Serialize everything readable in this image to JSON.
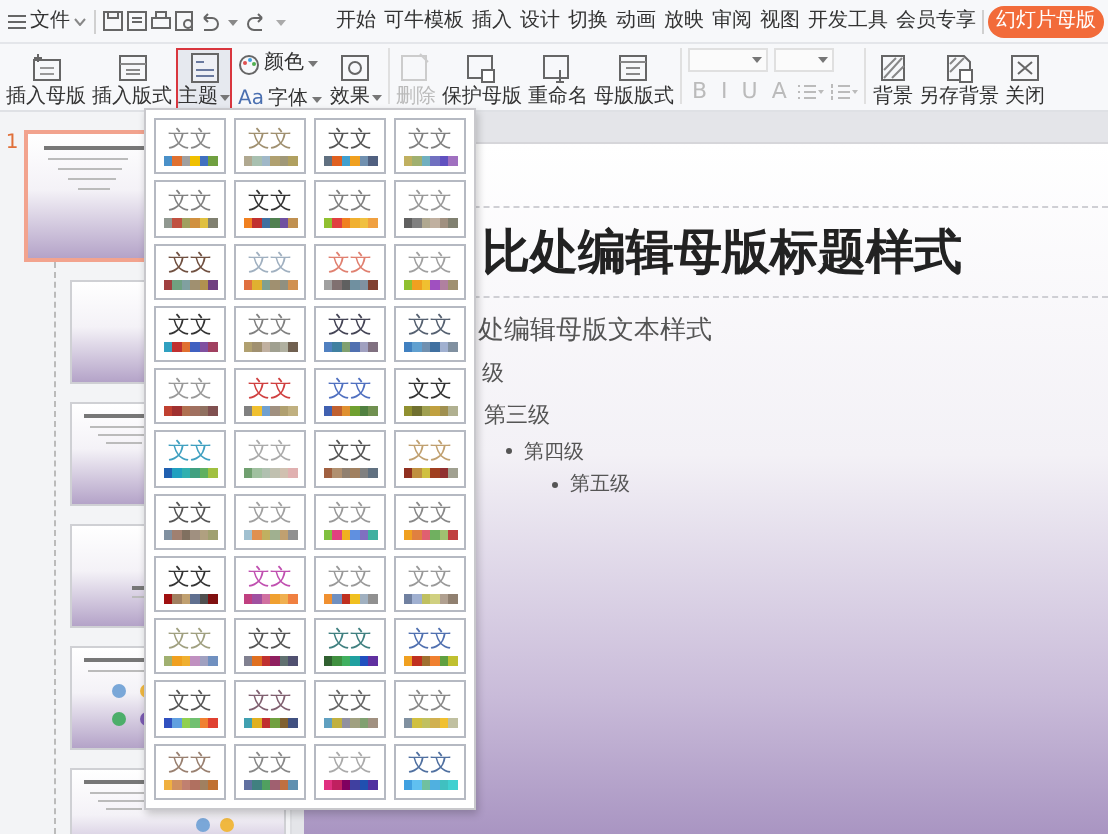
{
  "menu_bar": {
    "file_label": "文件",
    "tabs": [
      {
        "label": "开始",
        "selected": false
      },
      {
        "label": "可牛模板",
        "selected": false
      },
      {
        "label": "插入",
        "selected": false
      },
      {
        "label": "设计",
        "selected": false
      },
      {
        "label": "切换",
        "selected": false
      },
      {
        "label": "动画",
        "selected": false
      },
      {
        "label": "放映",
        "selected": false
      },
      {
        "label": "审阅",
        "selected": false
      },
      {
        "label": "视图",
        "selected": false
      },
      {
        "label": "开发工具",
        "selected": false
      },
      {
        "label": "会员专享",
        "selected": false
      },
      {
        "label": "幻灯片母版",
        "selected": true
      }
    ]
  },
  "ribbon": {
    "groups": [
      {
        "kind": "large",
        "label": "插入母版",
        "dropdown": false,
        "active": false,
        "disabled": false
      },
      {
        "kind": "large",
        "label": "插入版式",
        "dropdown": false,
        "active": false,
        "disabled": false
      },
      {
        "kind": "large",
        "label": "主题",
        "dropdown": true,
        "active": true,
        "disabled": false
      },
      {
        "kind": "stack",
        "items": [
          {
            "label": "颜色",
            "dropdown": true
          },
          {
            "label": "字体",
            "badge": "Aa",
            "dropdown": true
          }
        ]
      },
      {
        "kind": "large",
        "label": "效果",
        "dropdown": true,
        "active": false,
        "disabled": false
      },
      {
        "kind": "large",
        "label": "删除",
        "dropdown": false,
        "active": false,
        "disabled": true
      },
      {
        "kind": "large",
        "label": "保护母版",
        "dropdown": false,
        "active": false,
        "disabled": false
      },
      {
        "kind": "large",
        "label": "重命名",
        "dropdown": false,
        "active": false,
        "disabled": false
      },
      {
        "kind": "large",
        "label": "母版版式",
        "dropdown": false,
        "active": false,
        "disabled": false
      },
      {
        "kind": "font",
        "disabled": true,
        "format_buttons": [
          "B",
          "I",
          "U",
          "A"
        ]
      },
      {
        "kind": "large",
        "label": "背景",
        "dropdown": false,
        "active": false,
        "disabled": false
      },
      {
        "kind": "large",
        "label": "另存背景",
        "dropdown": false,
        "active": false,
        "disabled": false
      },
      {
        "kind": "large",
        "label": "关闭",
        "dropdown": false,
        "active": false,
        "disabled": false
      }
    ]
  },
  "thumbnails": [
    {
      "kind": "master",
      "number": "1",
      "selected": true
    },
    {
      "kind": "title",
      "selected": false
    },
    {
      "kind": "content_icons",
      "selected": false
    },
    {
      "kind": "section",
      "selected": false
    },
    {
      "kind": "icons",
      "selected": false
    },
    {
      "kind": "content_icons",
      "selected": false
    }
  ],
  "slide": {
    "title": "比处编辑母版标题样式",
    "body": [
      {
        "text": "处编辑母版文本样式",
        "bullet": false,
        "children": [
          {
            "text": "级",
            "bullet": false,
            "children": [
              {
                "text": "第三级",
                "bullet": false,
                "children": [
                  {
                    "text": "第四级",
                    "bullet": true,
                    "children": [
                      {
                        "text": "第五级",
                        "bullet": true
                      }
                    ]
                  }
                ]
              }
            ]
          }
        ]
      }
    ]
  },
  "themes": [
    {
      "label": "文文",
      "color": "#888888",
      "swatches": [
        {
          "color": "#4a90c8"
        },
        {
          "color": "#e07030"
        },
        {
          "color": "#a0a0a0"
        },
        {
          "color": "#f0c000"
        },
        {
          "color": "#4070c0"
        },
        {
          "color": "#70a040"
        }
      ]
    },
    {
      "label": "文文",
      "color": "#a09070",
      "swatches": [
        {
          "color": "#b0a890"
        },
        {
          "color": "#a8c0b0"
        },
        {
          "color": "#a0b8c8"
        },
        {
          "color": "#b0a070"
        },
        {
          "color": "#a09878"
        },
        {
          "color": "#b0a060"
        }
      ]
    },
    {
      "label": "文文",
      "color": "#555555",
      "swatches": [
        {
          "color": "#607080"
        },
        {
          "color": "#e06020"
        },
        {
          "color": "#40a0d0"
        },
        {
          "color": "#f0a020"
        },
        {
          "color": "#7090b0"
        },
        {
          "color": "#506080"
        }
      ]
    },
    {
      "label": "文文",
      "color": "#808080",
      "swatches": [
        {
          "color": "#c0b060"
        },
        {
          "color": "#a0b070"
        },
        {
          "color": "#70b0c0"
        },
        {
          "color": "#7070c0"
        },
        {
          "color": "#6050c0"
        },
        {
          "color": "#a070c0"
        }
      ]
    },
    {
      "label": "文文",
      "color": "#808080",
      "swatches": [
        {
          "color": "#909890"
        },
        {
          "color": "#c05040"
        },
        {
          "color": "#a0a060"
        },
        {
          "color": "#d09040"
        },
        {
          "color": "#e0c040"
        },
        {
          "color": "#808070"
        }
      ]
    },
    {
      "label": "文文",
      "color": "#333333",
      "swatches": [
        {
          "color": "#f08020"
        },
        {
          "color": "#c03030"
        },
        {
          "color": "#4070a0"
        },
        {
          "color": "#508050"
        },
        {
          "color": "#7050a0"
        },
        {
          "color": "#c09050"
        }
      ]
    },
    {
      "label": "文文",
      "color": "#808080",
      "swatches": [
        {
          "color": "#90c030"
        },
        {
          "color": "#e04040"
        },
        {
          "color": "#f08020"
        },
        {
          "color": "#f0b030"
        },
        {
          "color": "#f0c040"
        },
        {
          "color": "#f0a040"
        }
      ]
    },
    {
      "label": "文文",
      "color": "#999999",
      "swatches": [
        {
          "color": "#606060"
        },
        {
          "color": "#808080"
        },
        {
          "color": "#b0a890"
        },
        {
          "color": "#c0b0a0"
        },
        {
          "color": "#a09080"
        },
        {
          "color": "#808070"
        }
      ]
    },
    {
      "label": "文文",
      "color": "#705040",
      "swatches": [
        {
          "color": "#a04040"
        },
        {
          "color": "#70a080"
        },
        {
          "color": "#80a0a0"
        },
        {
          "color": "#a09070"
        },
        {
          "color": "#b09050"
        },
        {
          "color": "#704080"
        }
      ]
    },
    {
      "label": "文文",
      "color": "#a0b0c0",
      "swatches": [
        {
          "color": "#e07040"
        },
        {
          "color": "#e0b030"
        },
        {
          "color": "#80a090"
        },
        {
          "color": "#a09070"
        },
        {
          "color": "#909080"
        },
        {
          "color": "#d09050"
        }
      ]
    },
    {
      "label": "文文",
      "color": "#e08070",
      "swatches": [
        {
          "color": "#a0a0a0"
        },
        {
          "color": "#807070"
        },
        {
          "color": "#606060"
        },
        {
          "color": "#7090a0"
        },
        {
          "color": "#8090a0"
        },
        {
          "color": "#804030"
        }
      ]
    },
    {
      "label": "文文",
      "color": "#a0a0a0",
      "swatches": [
        {
          "color": "#90c030"
        },
        {
          "color": "#f0a020"
        },
        {
          "color": "#f0c030"
        },
        {
          "color": "#a050c0"
        },
        {
          "color": "#b080a0"
        },
        {
          "color": "#a09070"
        }
      ]
    },
    {
      "label": "文文",
      "color": "#333333",
      "swatches": [
        {
          "color": "#30a0c0"
        },
        {
          "color": "#c03030"
        },
        {
          "color": "#e07030"
        },
        {
          "color": "#4060c0"
        },
        {
          "color": "#8050a0"
        },
        {
          "color": "#a04060"
        }
      ]
    },
    {
      "label": "文文",
      "color": "#808080",
      "swatches": [
        {
          "color": "#b0a070"
        },
        {
          "color": "#a09070"
        },
        {
          "color": "#c0b0a0"
        },
        {
          "color": "#a0a090"
        },
        {
          "color": "#b0b0a0"
        },
        {
          "color": "#706050"
        }
      ]
    },
    {
      "label": "文文",
      "color": "#444455",
      "swatches": [
        {
          "color": "#5080c0"
        },
        {
          "color": "#4080a0"
        },
        {
          "color": "#80a070"
        },
        {
          "color": "#5070b0"
        },
        {
          "color": "#a0a0c0"
        },
        {
          "color": "#807080"
        }
      ]
    },
    {
      "label": "文文",
      "color": "#556070",
      "swatches": [
        {
          "color": "#4080c0"
        },
        {
          "color": "#60a0d0"
        },
        {
          "color": "#7090b0"
        },
        {
          "color": "#4070a0"
        },
        {
          "color": "#a0b0d0"
        },
        {
          "color": "#8090a0"
        }
      ]
    },
    {
      "label": "文文",
      "color": "#999999",
      "swatches": [
        {
          "color": "#c04030"
        },
        {
          "color": "#a03030"
        },
        {
          "color": "#b07050"
        },
        {
          "color": "#a07060"
        },
        {
          "color": "#907060"
        },
        {
          "color": "#805050"
        }
      ]
    },
    {
      "label": "文文",
      "color": "#d04040",
      "swatches": [
        {
          "color": "#808080"
        },
        {
          "color": "#f0c030"
        },
        {
          "color": "#70a0d0"
        },
        {
          "color": "#a09080"
        },
        {
          "color": "#b0a070"
        },
        {
          "color": "#c0b080"
        }
      ]
    },
    {
      "label": "文文",
      "color": "#5070c0",
      "swatches": [
        {
          "color": "#4060b0"
        },
        {
          "color": "#c06030"
        },
        {
          "color": "#e09030"
        },
        {
          "color": "#70a030"
        },
        {
          "color": "#508040"
        },
        {
          "color": "#709050"
        }
      ]
    },
    {
      "label": "文文",
      "color": "#333333",
      "swatches": [
        {
          "color": "#909030"
        },
        {
          "color": "#707030"
        },
        {
          "color": "#a0a050"
        },
        {
          "color": "#c0a040"
        },
        {
          "color": "#a09050"
        },
        {
          "color": "#b0b090"
        }
      ]
    },
    {
      "label": "文文",
      "color": "#40a0c0",
      "swatches": [
        {
          "color": "#2060b0"
        },
        {
          "color": "#20a0c0"
        },
        {
          "color": "#30b0b0"
        },
        {
          "color": "#40a080"
        },
        {
          "color": "#60b060"
        },
        {
          "color": "#a0c040"
        }
      ]
    },
    {
      "label": "文文",
      "color": "#aaaaaa",
      "swatches": [
        {
          "color": "#70a070"
        },
        {
          "color": "#a0c0a0"
        },
        {
          "color": "#b0c0b0"
        },
        {
          "color": "#c0c0b0"
        },
        {
          "color": "#d0c0b0"
        },
        {
          "color": "#e0b0b0"
        }
      ]
    },
    {
      "label": "文文",
      "color": "#555555",
      "swatches": [
        {
          "color": "#a06040"
        },
        {
          "color": "#b09070"
        },
        {
          "color": "#908070"
        },
        {
          "color": "#a08060"
        },
        {
          "color": "#808080"
        },
        {
          "color": "#607080"
        }
      ]
    },
    {
      "label": "文文",
      "color": "#c0a070",
      "swatches": [
        {
          "color": "#903020"
        },
        {
          "color": "#c09040"
        },
        {
          "color": "#d0c040"
        },
        {
          "color": "#a04020"
        },
        {
          "color": "#903030"
        },
        {
          "color": "#a0a090"
        }
      ]
    },
    {
      "label": "文文",
      "color": "#555555",
      "swatches": [
        {
          "color": "#8090a0"
        },
        {
          "color": "#a08070"
        },
        {
          "color": "#807060"
        },
        {
          "color": "#a09080"
        },
        {
          "color": "#b0a080"
        },
        {
          "color": "#a0a070"
        }
      ]
    },
    {
      "label": "文文",
      "color": "#a0a0a0",
      "swatches": [
        {
          "color": "#a0c0d0"
        },
        {
          "color": "#e09050"
        },
        {
          "color": "#c0b060"
        },
        {
          "color": "#a0b090"
        },
        {
          "color": "#c0a070"
        },
        {
          "color": "#909090"
        }
      ]
    },
    {
      "label": "文文",
      "color": "#999999",
      "swatches": [
        {
          "color": "#80c040"
        },
        {
          "color": "#e04080"
        },
        {
          "color": "#f0b020"
        },
        {
          "color": "#6090e0"
        },
        {
          "color": "#8070c0"
        },
        {
          "color": "#40b0a0"
        }
      ]
    },
    {
      "label": "文文",
      "color": "#888888",
      "swatches": [
        {
          "color": "#f0a020"
        },
        {
          "color": "#e08040"
        },
        {
          "color": "#e06070"
        },
        {
          "color": "#70b060"
        },
        {
          "color": "#a0c070"
        },
        {
          "color": "#c04040"
        }
      ]
    },
    {
      "label": "文文",
      "color": "#333333",
      "swatches": [
        {
          "color": "#a01010"
        },
        {
          "color": "#a08060"
        },
        {
          "color": "#c0a070"
        },
        {
          "color": "#607090"
        },
        {
          "color": "#505050"
        },
        {
          "color": "#801010"
        }
      ]
    },
    {
      "label": "文文",
      "color": "#c050b0",
      "swatches": [
        {
          "color": "#c04080"
        },
        {
          "color": "#a050a0"
        },
        {
          "color": "#d070a0"
        },
        {
          "color": "#f0a030"
        },
        {
          "color": "#f0b050"
        },
        {
          "color": "#f08040"
        }
      ]
    },
    {
      "label": "文文",
      "color": "#999999",
      "swatches": [
        {
          "color": "#f09030"
        },
        {
          "color": "#7090c0"
        },
        {
          "color": "#c03020"
        },
        {
          "color": "#f0c020"
        },
        {
          "color": "#a0b0c0"
        },
        {
          "color": "#909090"
        }
      ]
    },
    {
      "label": "文文",
      "color": "#999999",
      "swatches": [
        {
          "color": "#7080a0"
        },
        {
          "color": "#a0b0d0"
        },
        {
          "color": "#c0c060"
        },
        {
          "color": "#d0d080"
        },
        {
          "color": "#b0a090"
        },
        {
          "color": "#908070"
        }
      ]
    },
    {
      "label": "文文",
      "color": "#a0a080",
      "swatches": [
        {
          "color": "#a0b070"
        },
        {
          "color": "#f0a020"
        },
        {
          "color": "#f0b030"
        },
        {
          "color": "#c090c0"
        },
        {
          "color": "#a0a0c0"
        },
        {
          "color": "#7090c0"
        }
      ]
    },
    {
      "label": "文文",
      "color": "#555555",
      "swatches": [
        {
          "color": "#808090"
        },
        {
          "color": "#e07020"
        },
        {
          "color": "#c03030"
        },
        {
          "color": "#902060"
        },
        {
          "color": "#607070"
        },
        {
          "color": "#505070"
        }
      ]
    },
    {
      "label": "文文",
      "color": "#408080",
      "swatches": [
        {
          "color": "#306030"
        },
        {
          "color": "#409040"
        },
        {
          "color": "#40b060"
        },
        {
          "color": "#20a0a0"
        },
        {
          "color": "#2050c0"
        },
        {
          "color": "#6030a0"
        }
      ]
    },
    {
      "label": "文文",
      "color": "#5070b0",
      "swatches": [
        {
          "color": "#f0a020"
        },
        {
          "color": "#c03020"
        },
        {
          "color": "#a07030"
        },
        {
          "color": "#f08030"
        },
        {
          "color": "#60a040"
        },
        {
          "color": "#c0c030"
        }
      ]
    },
    {
      "label": "文文",
      "color": "#555555",
      "swatches": [
        {
          "color": "#3050c0"
        },
        {
          "color": "#60a0e0"
        },
        {
          "color": "#90d050"
        },
        {
          "color": "#70c070"
        },
        {
          "color": "#f08030"
        },
        {
          "color": "#e04030"
        }
      ]
    },
    {
      "label": "文文",
      "color": "#806070",
      "swatches": [
        {
          "color": "#40a0b0"
        },
        {
          "color": "#e0b020"
        },
        {
          "color": "#c03030"
        },
        {
          "color": "#70a040"
        },
        {
          "color": "#806030"
        },
        {
          "color": "#405080"
        }
      ]
    },
    {
      "label": "文文",
      "color": "#666666",
      "swatches": [
        {
          "color": "#60a0c0"
        },
        {
          "color": "#c0b040"
        },
        {
          "color": "#9090a0"
        },
        {
          "color": "#a0a080"
        },
        {
          "color": "#80a070"
        },
        {
          "color": "#a09080"
        }
      ]
    },
    {
      "label": "文文",
      "color": "#888888",
      "swatches": [
        {
          "color": "#8090a0"
        },
        {
          "color": "#d0c040"
        },
        {
          "color": "#c0c060"
        },
        {
          "color": "#d0b050"
        },
        {
          "color": "#f0c030"
        },
        {
          "color": "#c0c0a0"
        }
      ]
    },
    {
      "label": "文文",
      "color": "#998070",
      "swatches": [
        {
          "color": "#f0b040"
        },
        {
          "color": "#d09060"
        },
        {
          "color": "#c08070"
        },
        {
          "color": "#b07060"
        },
        {
          "color": "#a08060"
        },
        {
          "color": "#c07030"
        }
      ]
    },
    {
      "label": "文文",
      "color": "#888888",
      "swatches": [
        {
          "color": "#6070a0"
        },
        {
          "color": "#408080"
        },
        {
          "color": "#50a060"
        },
        {
          "color": "#a06070"
        },
        {
          "color": "#c07040"
        },
        {
          "color": "#6090b0"
        }
      ]
    },
    {
      "label": "文文",
      "color": "#aaaaaa",
      "swatches": [
        {
          "color": "#e03080"
        },
        {
          "color": "#c02060"
        },
        {
          "color": "#800060"
        },
        {
          "color": "#4040a0"
        },
        {
          "color": "#2050b0"
        },
        {
          "color": "#5030a0"
        }
      ]
    },
    {
      "label": "文文",
      "color": "#5070a0",
      "swatches": [
        {
          "color": "#40a0e0"
        },
        {
          "color": "#60c0f0"
        },
        {
          "color": "#70c0a0"
        },
        {
          "color": "#50b0e0"
        },
        {
          "color": "#40c0c0"
        },
        {
          "color": "#40d0d0"
        }
      ]
    }
  ]
}
